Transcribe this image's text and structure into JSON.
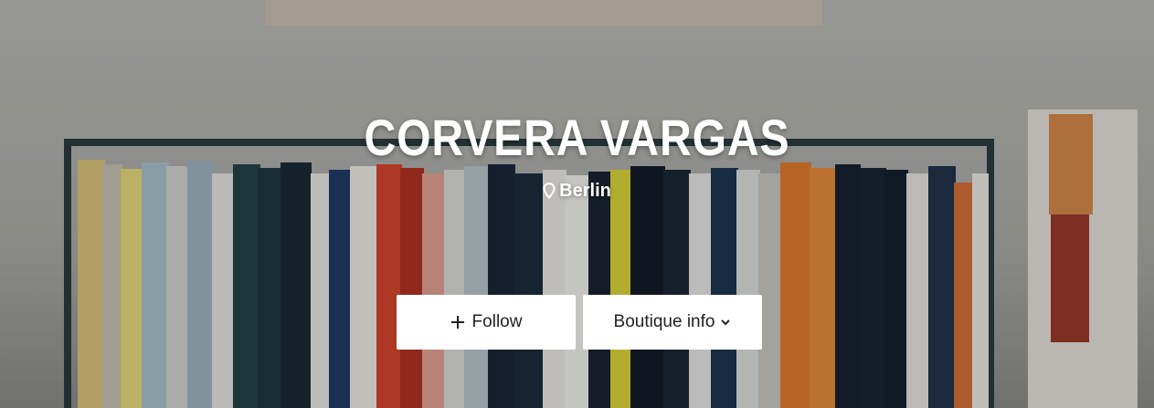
{
  "hero": {
    "title": "CORVERA VARGAS",
    "location": "Berlin",
    "icons": {
      "location": "map-pin-icon",
      "follow": "plus-icon",
      "info": "chevron-down-icon"
    }
  },
  "actions": {
    "follow_label": "Follow",
    "info_label": "Boutique info"
  },
  "colors": {
    "button_bg": "#ffffff",
    "button_text": "#222222",
    "title_text": "#ffffff"
  }
}
